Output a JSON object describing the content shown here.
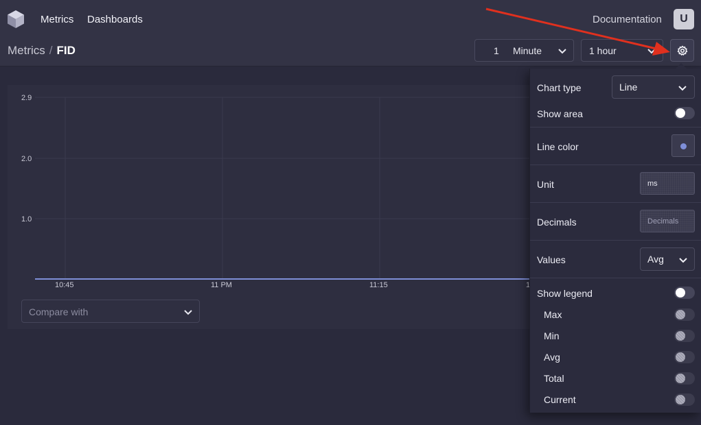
{
  "nav": {
    "links": [
      "Metrics",
      "Dashboards"
    ],
    "documentation": "Documentation",
    "avatar_initial": "U"
  },
  "breadcrumb": {
    "root": "Metrics",
    "separator": "/",
    "current": "FID"
  },
  "controls": {
    "interval_value": "1",
    "interval_unit": "Minute",
    "time_range": "1 hour"
  },
  "chart": {
    "y_ticks": [
      "2.9",
      "2.0",
      "1.0"
    ],
    "x_ticks": [
      "10:45",
      "11 PM",
      "11:15",
      "1"
    ],
    "line_color": "#7f8fd8",
    "compare_placeholder": "Compare with"
  },
  "settings": {
    "chart_type_label": "Chart type",
    "chart_type_value": "Line",
    "show_area_label": "Show area",
    "line_color_label": "Line color",
    "line_color_value": "#7f8fd8",
    "unit_label": "Unit",
    "unit_value": "ms",
    "decimals_label": "Decimals",
    "decimals_placeholder": "Decimals",
    "values_label": "Values",
    "values_value": "Avg",
    "show_legend_label": "Show legend",
    "legend_items": [
      "Max",
      "Min",
      "Avg",
      "Total",
      "Current"
    ]
  },
  "colors": {
    "background": "#2a2a3c",
    "topbar": "#333345",
    "panel": "#2e2e40",
    "annotation_arrow": "#e0301e"
  }
}
